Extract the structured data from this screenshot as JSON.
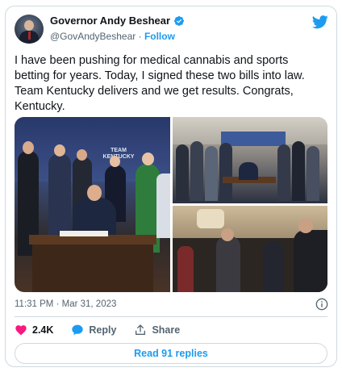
{
  "author": {
    "display_name": "Governor Andy Beshear",
    "handle": "@GovAndyBeshear",
    "separator": "·",
    "follow_label": "Follow",
    "verified": true
  },
  "tweet": {
    "lines": [
      "I have been pushing for medical cannabis and sports",
      "betting for years. Today, I signed these two bills into law.",
      "Team Kentucky delivers and we get results. Congrats,",
      "Kentucky."
    ],
    "time": "11:31 PM",
    "date_separator": "·",
    "date": "Mar 31, 2023"
  },
  "media": {
    "photos": [
      {
        "id": "signing-photo",
        "backdrop_text": "TEAM KENTUCKY"
      },
      {
        "id": "group-photo"
      },
      {
        "id": "applause-photo"
      }
    ]
  },
  "actions": {
    "likes": "2.4K",
    "reply_label": "Reply",
    "share_label": "Share"
  },
  "replies_button": "Read 91 replies",
  "colors": {
    "accent": "#1d9bf0",
    "like": "#f91880",
    "text": "#0f1419",
    "muted": "#536471",
    "border": "#cfd9de"
  },
  "icons": [
    "verified-icon",
    "twitter-bird-icon",
    "info-icon",
    "heart-icon",
    "reply-bubble-icon",
    "share-icon"
  ]
}
